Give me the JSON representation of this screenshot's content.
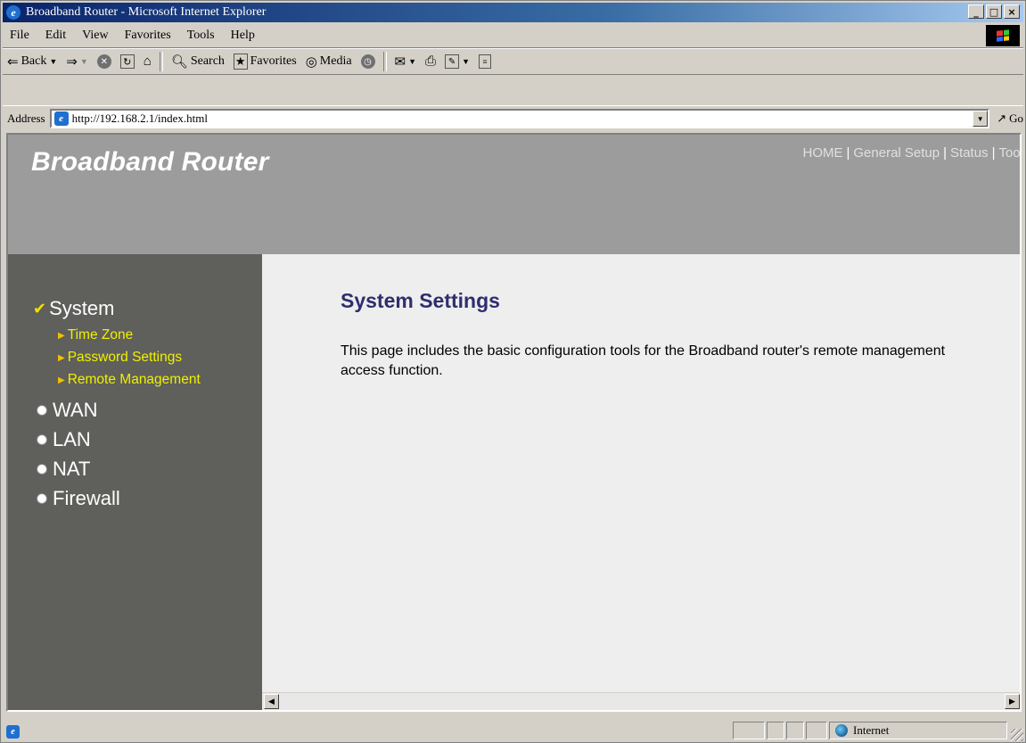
{
  "window": {
    "title": "Broadband Router - Microsoft Internet Explorer",
    "buttons": {
      "minimize": "_",
      "maximize": "□",
      "close": "×"
    }
  },
  "menu": [
    "File",
    "Edit",
    "View",
    "Favorites",
    "Tools",
    "Help"
  ],
  "toolbar": {
    "back": "Back",
    "search": "Search",
    "favorites": "Favorites",
    "media": "Media"
  },
  "address": {
    "label": "Address",
    "url": "http://192.168.2.1/index.html",
    "go": "Go"
  },
  "page": {
    "brand": "Broadband Router",
    "topnav": [
      "HOME",
      "General Setup",
      "Status",
      "Tool"
    ],
    "sidebar": {
      "sections": [
        {
          "label": "System",
          "active": true,
          "items": [
            "Time Zone",
            "Password Settings",
            "Remote Management"
          ]
        },
        {
          "label": "WAN"
        },
        {
          "label": "LAN"
        },
        {
          "label": "NAT"
        },
        {
          "label": "Firewall"
        }
      ]
    },
    "title": "System Settings",
    "description": "This page includes the basic configuration tools for the Broadband router's remote management access function."
  },
  "status": {
    "zone": "Internet"
  },
  "colors": {
    "header_bg": "#9c9c9c",
    "sidebar_bg": "#5f5f5c",
    "content_bg": "#eeeeee",
    "title_color": "#2e2e6e",
    "submenu_color": "#f0f000"
  }
}
